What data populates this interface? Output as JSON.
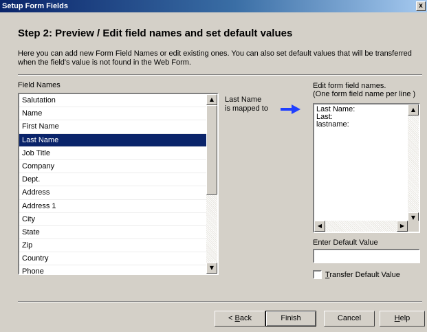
{
  "window": {
    "title": "Setup Form Fields",
    "close_glyph": "x"
  },
  "step_title": "Step 2: Preview / Edit field names and set default values",
  "description": "Here you can add new Form Field Names or edit existing ones. You can also set default values that will be transferred when the field's value is not found in the Web Form.",
  "field_names": {
    "label": "Field Names",
    "items": [
      "Salutation",
      "Name",
      "First Name",
      "Last Name",
      "Job Title",
      "Company",
      "Dept.",
      "Address",
      "Address 1",
      "City",
      "State",
      "Zip",
      "Country",
      "Phone"
    ],
    "selected": "Last Name"
  },
  "mapping": {
    "field": "Last Name",
    "text": "is mapped to",
    "arrow_color": "#1f3fff"
  },
  "edit_names": {
    "label_line1": "Edit form field names.",
    "label_line2": "(One form field name per line )",
    "lines": [
      "Last Name:",
      "Last:",
      "lastname:"
    ]
  },
  "default_value": {
    "label": "Enter Default Value",
    "value": ""
  },
  "transfer_default": {
    "checked": false,
    "label_prefix": "",
    "label_underlined": "T",
    "label_rest": "ransfer Default Value"
  },
  "buttons": {
    "back": {
      "prefix": "< ",
      "underlined": "B",
      "rest": "ack"
    },
    "finish": "Finish",
    "cancel": "Cancel",
    "help": {
      "underlined": "H",
      "rest": "elp"
    }
  },
  "colors": {
    "selection": "#0a246a",
    "title_bar": "#0a246a",
    "dialog_bg": "#d4d0c8"
  }
}
